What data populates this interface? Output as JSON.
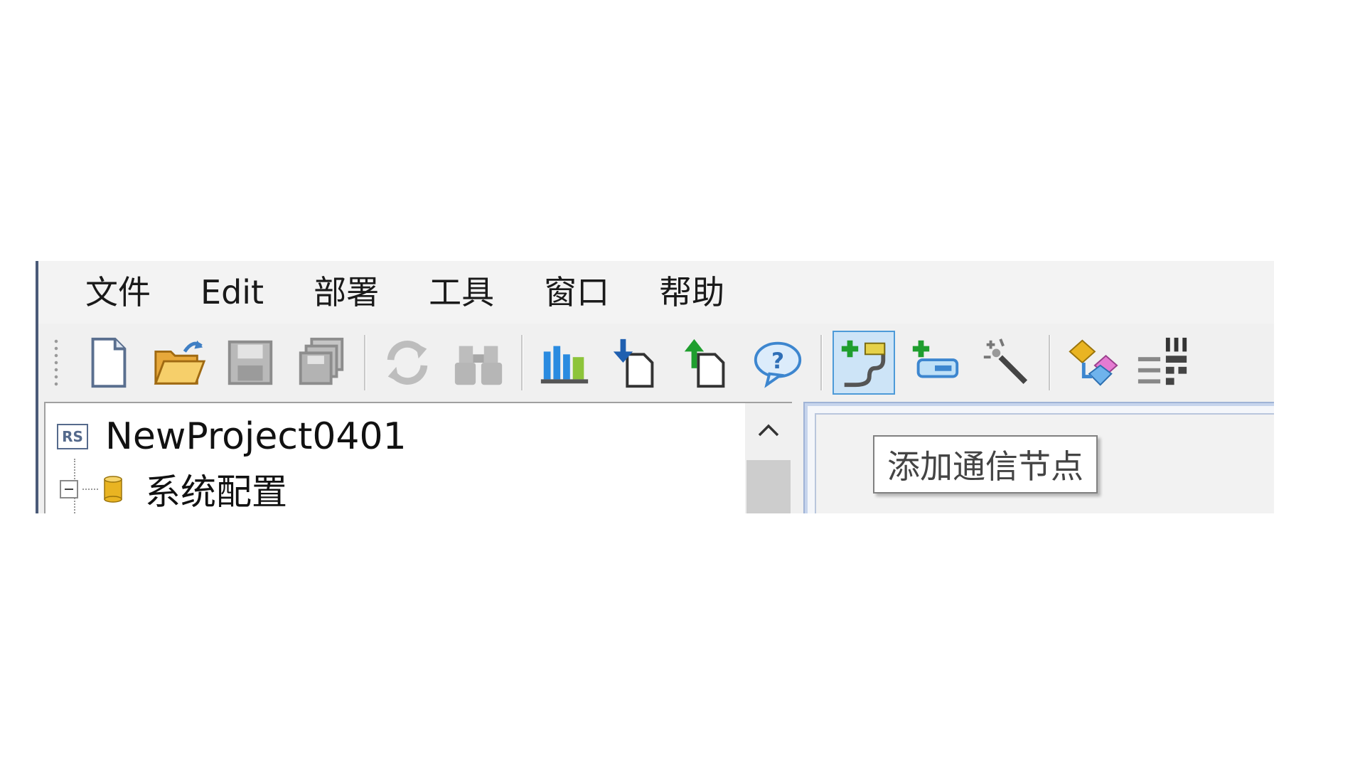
{
  "menu": [
    "文件",
    "Edit",
    "部署",
    "工具",
    "窗口",
    "帮助"
  ],
  "toolbar": {
    "buttons": [
      {
        "name": "new-file",
        "icon": "new-document-icon"
      },
      {
        "name": "open",
        "icon": "open-folder-icon"
      },
      {
        "name": "save",
        "icon": "save-disk-icon"
      },
      {
        "name": "save-all",
        "icon": "save-all-icon"
      },
      {
        "name": "refresh",
        "icon": "refresh-icon"
      },
      {
        "name": "find",
        "icon": "binoculars-icon"
      },
      {
        "name": "chart",
        "icon": "bar-chart-icon"
      },
      {
        "name": "download",
        "icon": "download-icon"
      },
      {
        "name": "upload",
        "icon": "upload-icon"
      },
      {
        "name": "help",
        "icon": "help-bubble-icon"
      },
      {
        "name": "add-comm-node",
        "icon": "add-plug-icon",
        "active": true
      },
      {
        "name": "add-device",
        "icon": "add-device-icon"
      },
      {
        "name": "wizard",
        "icon": "magic-wand-icon"
      },
      {
        "name": "mapping",
        "icon": "diamond-arrow-icon"
      },
      {
        "name": "grid",
        "icon": "grid-icon"
      }
    ]
  },
  "tree": {
    "root_badge": "RS",
    "root_label": "NewProject0401",
    "child_label": "系统配置"
  },
  "tooltip": "添加通信节点",
  "colors": {
    "accent": "#4d9ad8",
    "active_bg": "#cde4f7",
    "green_plus": "#1f9e2e",
    "yellow_db": "#e9b422"
  }
}
